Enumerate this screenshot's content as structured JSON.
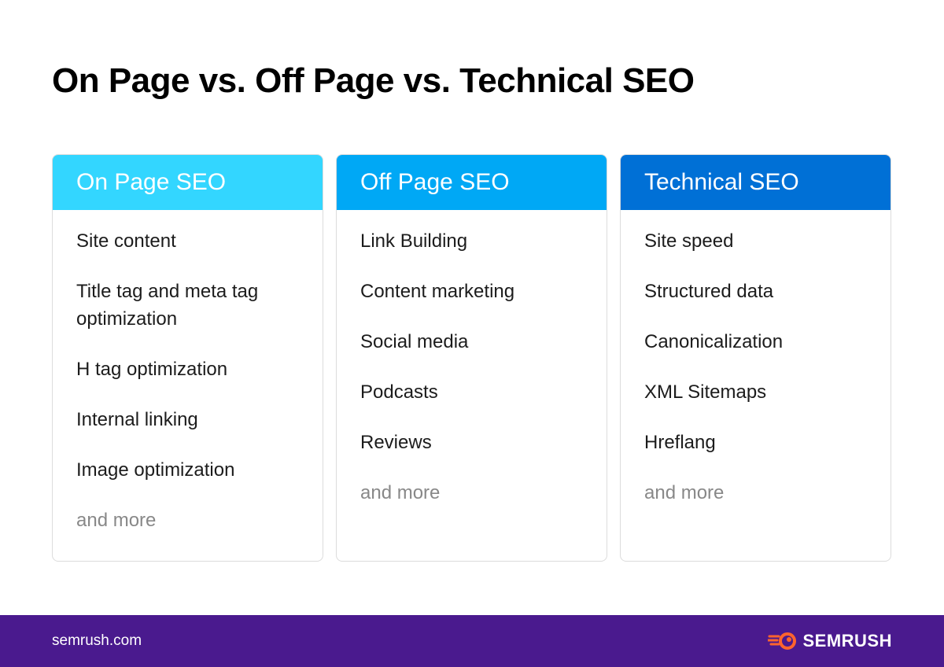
{
  "title": "On Page vs. Off Page vs. Technical SEO",
  "columns": [
    {
      "header": "On Page SEO",
      "color": "#33d6ff",
      "items": [
        "Site content",
        "Title tag and meta tag optimization",
        "H tag optimization",
        "Internal linking",
        "Image optimization"
      ],
      "more": "and more"
    },
    {
      "header": "Off Page SEO",
      "color": "#00a8f5",
      "items": [
        "Link Building",
        "Content marketing",
        "Social media",
        "Podcasts",
        "Reviews"
      ],
      "more": "and more"
    },
    {
      "header": "Technical SEO",
      "color": "#0070d6",
      "items": [
        "Site speed",
        "Structured data",
        "Canonicalization",
        "XML Sitemaps",
        "Hreflang"
      ],
      "more": "and more"
    }
  ],
  "footer": {
    "url": "semrush.com",
    "logo_text": "SEMRUSH",
    "logo_icon": "semrush-fireball-icon",
    "logo_color": "#ff642d",
    "background": "#4a1a8e"
  }
}
